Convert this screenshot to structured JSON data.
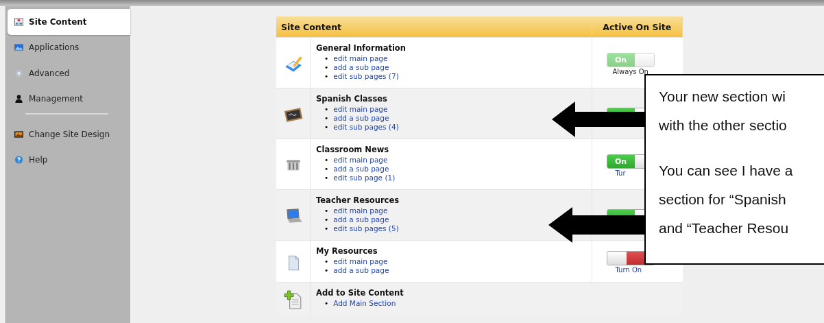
{
  "sidebar": {
    "items": [
      {
        "label": "Site Content",
        "selected": true
      },
      {
        "label": "Applications",
        "selected": false
      },
      {
        "label": "Advanced",
        "selected": false
      },
      {
        "label": "Management",
        "selected": false
      }
    ],
    "bottom_items": [
      {
        "label": "Change Site Design",
        "selected": false
      },
      {
        "label": "Help",
        "selected": false
      }
    ]
  },
  "table": {
    "columns": [
      "Site Content",
      "Active On Site"
    ],
    "bullet": "•",
    "rows": [
      {
        "title": "General Information",
        "links": [
          "edit main page",
          "add a sub page",
          "edit sub pages (7)"
        ],
        "toggle": {
          "on": true,
          "locked": true,
          "label": "On",
          "caption": "Always On"
        }
      },
      {
        "title": "Spanish Classes",
        "links": [
          "edit main page",
          "add a sub page",
          "edit sub pages (4)"
        ],
        "toggle": {
          "on": true,
          "locked": false
        }
      },
      {
        "title": "Classroom News",
        "links": [
          "edit main page",
          "add a sub page",
          "edit sub page (1)"
        ],
        "toggle": {
          "on": true,
          "locked": false,
          "label": "On",
          "caption": "Tur"
        }
      },
      {
        "title": "Teacher Resources",
        "links": [
          "edit main page",
          "add a sub page",
          "edit sub pages (5)"
        ],
        "toggle": {
          "on": true,
          "locked": false
        }
      },
      {
        "title": "My Resources",
        "links": [
          "edit main page",
          "add a sub page"
        ],
        "toggle": {
          "on": false,
          "locked": false,
          "caption": "Turn On"
        }
      },
      {
        "title": "Add to Site Content",
        "links": [
          "Add Main Section"
        ]
      }
    ]
  },
  "callout": {
    "paragraphs": [
      [
        "Your new section wi",
        "with the other sectio"
      ],
      [
        "You can see I have a",
        "section for “Spanish",
        "and “Teacher Resou"
      ]
    ]
  }
}
